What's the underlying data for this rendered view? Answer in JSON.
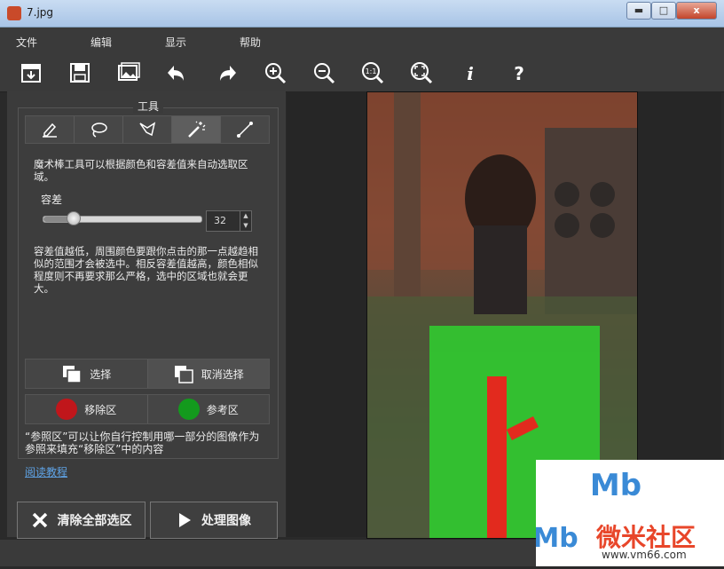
{
  "window": {
    "title": "7.jpg",
    "min_label": "▬",
    "max_label": "□",
    "close_label": "x"
  },
  "menu": {
    "file": "文件",
    "edit": "编辑",
    "view": "显示",
    "help": "帮助"
  },
  "toolbar": [
    "open-icon",
    "save-icon",
    "image-icon",
    "undo-icon",
    "redo-icon",
    "zoom-in-icon",
    "zoom-out-icon",
    "actual-size-icon",
    "fit-icon",
    "info-icon",
    "help-icon"
  ],
  "tools": {
    "label": "工具",
    "description": "魔术棒工具可以根据颜色和容差值来自动选取区域。",
    "tolerance_label": "容差",
    "tolerance_value": "32",
    "tolerance_fraction": 0.16,
    "tolerance_desc": "容差值越低，周围颜色要跟你点击的那一点越趋相似的范围才会被选中。相反容差值越高，颜色相似程度则不再要求那么严格，选中的区域也就会更大。",
    "select_label": "选择",
    "deselect_label": "取消选择",
    "remove_label": "移除区",
    "reference_label": "参考区",
    "reference_desc": "“参照区”可以让你自行控制用哪一部分的图像作为参照来填充“移除区”中的内容",
    "read_tutorial": "阅读教程"
  },
  "actions": {
    "clear_all": "清除全部选区",
    "process": "处理图像"
  },
  "colors": {
    "remove": "#c0161b",
    "reference": "#139a1d",
    "accent_link": "#5fa3e6",
    "mask_green": "#2fd12f",
    "mask_red": "#e22a1e"
  },
  "watermark": {
    "text": "微米社区",
    "url": "www.vm66.com"
  }
}
